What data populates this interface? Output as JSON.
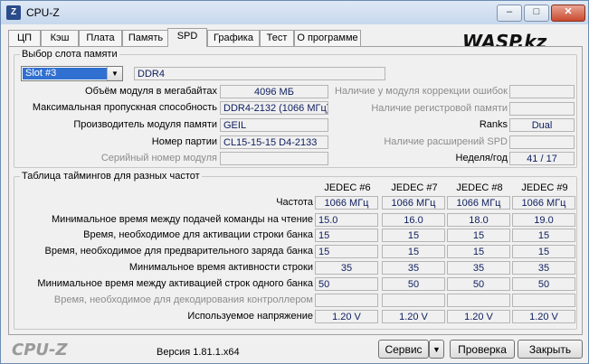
{
  "window": {
    "title": "CPU-Z",
    "minimize": "–",
    "maximize": "□",
    "close": "✕",
    "app_icon": "cpu-z-icon"
  },
  "tabs": [
    {
      "label": "ЦП"
    },
    {
      "label": "Кэш"
    },
    {
      "label": "Плата"
    },
    {
      "label": "Память"
    },
    {
      "label": "SPD",
      "active": true
    },
    {
      "label": "Графика"
    },
    {
      "label": "Тест"
    },
    {
      "label": "О программе"
    }
  ],
  "watermark": "WASP.kz",
  "slot": {
    "group_title": "Выбор слота памяти",
    "selected": "Slot #3",
    "type": "DDR4",
    "rows_left": [
      {
        "label": "Объём модуля в мегабайтах",
        "value": "4096 МБ",
        "disabled": false
      },
      {
        "label": "Максимальная пропускная способность",
        "value": "DDR4-2132 (1066 МГц)",
        "disabled": false
      },
      {
        "label": "Производитель модуля памяти",
        "value": "GEIL",
        "disabled": false
      },
      {
        "label": "Номер партии",
        "value": "CL15-15-15 D4-2133",
        "disabled": false
      },
      {
        "label": "Серийный номер модуля",
        "value": "",
        "disabled": true
      }
    ],
    "rows_right": [
      {
        "label": "Наличие у модуля коррекции ошибок",
        "value": "",
        "disabled": true
      },
      {
        "label": "Наличие регистровой памяти",
        "value": "",
        "disabled": true
      },
      {
        "label": "Ranks",
        "value": "Dual",
        "disabled": false
      },
      {
        "label": "Наличие расширений SPD",
        "value": "",
        "disabled": true
      },
      {
        "label": "Неделя/год",
        "value": "41 / 17",
        "disabled": false
      }
    ]
  },
  "timings": {
    "group_title": "Таблица таймингов для разных частот",
    "columns": [
      "JEDEC #6",
      "JEDEC #7",
      "JEDEC #8",
      "JEDEC #9"
    ],
    "rows": [
      {
        "label": "Частота",
        "values": [
          "1066 МГц",
          "1066 МГц",
          "1066 МГц",
          "1066 МГц"
        ],
        "disabled": false
      },
      {
        "label": "Минимальное время между подачей команды на чтение",
        "values": [
          "15.0",
          "16.0",
          "18.0",
          "19.0"
        ],
        "disabled": false
      },
      {
        "label": "Время, необходимое для активации строки банка",
        "values": [
          "15",
          "15",
          "15",
          "15"
        ],
        "disabled": false
      },
      {
        "label": "Время, необходимое для предварительного заряда банка",
        "values": [
          "15",
          "15",
          "15",
          "15"
        ],
        "disabled": false
      },
      {
        "label": "Минимальное время активности строки",
        "values": [
          "35",
          "35",
          "35",
          "35"
        ],
        "disabled": false
      },
      {
        "label": "Минимальное время между активацией строк одного банка",
        "values": [
          "50",
          "50",
          "50",
          "50"
        ],
        "disabled": false
      },
      {
        "label": "Время, необходимое для декодирования контроллером",
        "values": [
          "",
          "",
          "",
          ""
        ],
        "disabled": true
      },
      {
        "label": "Используемое напряжение",
        "values": [
          "1.20 V",
          "1.20 V",
          "1.20 V",
          "1.20 V"
        ],
        "disabled": false
      }
    ]
  },
  "footer": {
    "logo": "CPU-Z",
    "version": "Версия 1.81.1.x64",
    "service_label": "Сервис",
    "service_arrow": "▼",
    "verify_label": "Проверка",
    "close_label": "Закрыть"
  }
}
